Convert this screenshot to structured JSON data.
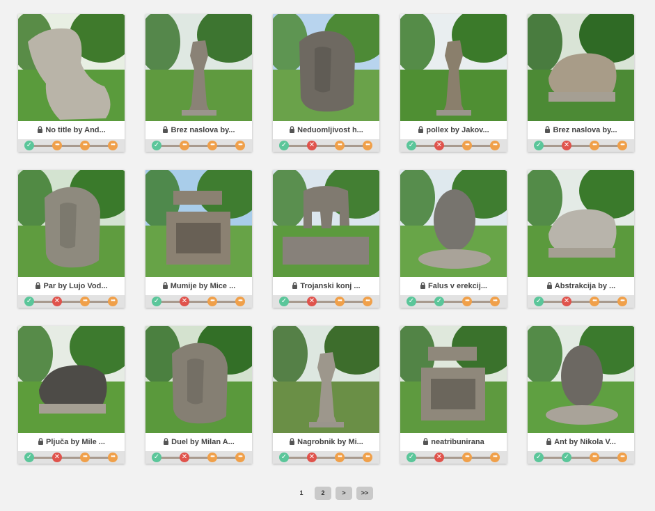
{
  "cards": [
    {
      "title": "No title by And...",
      "status": [
        "ok",
        "pend",
        "pend",
        "pend"
      ],
      "scene": {
        "sky": "#e8efe3",
        "grass": "#5a9b3c",
        "stone": "#b9b4a8",
        "shape": "tilt",
        "tree": "#3f7a2c"
      }
    },
    {
      "title": "Brez naslova by...",
      "status": [
        "ok",
        "pend",
        "pend",
        "pend"
      ],
      "scene": {
        "sky": "#dfe8e2",
        "grass": "#5f9a3f",
        "stone": "#8a8276",
        "shape": "pillar",
        "tree": "#3d7530"
      }
    },
    {
      "title": "Neduomljivost h...",
      "status": [
        "ok",
        "no",
        "pend",
        "pend"
      ],
      "scene": {
        "sky": "#b8d4ee",
        "grass": "#6aa24a",
        "stone": "#6e6961",
        "shape": "block",
        "tree": "#4d8a36"
      }
    },
    {
      "title": "pollex by Jakov...",
      "status": [
        "ok",
        "no",
        "pend",
        "pend"
      ],
      "scene": {
        "sky": "#e9eef0",
        "grass": "#4f8f33",
        "stone": "#8a7f6c",
        "shape": "pillar",
        "tree": "#3b7a2a"
      }
    },
    {
      "title": "Brez naslova by...",
      "status": [
        "ok",
        "no",
        "pend",
        "pend"
      ],
      "scene": {
        "sky": "#d9e4d6",
        "grass": "#4c8a35",
        "stone": "#a89c88",
        "shape": "low",
        "tree": "#2f6a25"
      }
    },
    {
      "title": "Par by Lujo Vod...",
      "status": [
        "ok",
        "no",
        "pend",
        "pend"
      ],
      "scene": {
        "sky": "#d3e3d0",
        "grass": "#5f9c3f",
        "stone": "#8e8a7e",
        "shape": "block",
        "tree": "#3a7a2b"
      }
    },
    {
      "title": "Mumije by Mice ...",
      "status": [
        "ok",
        "no",
        "pend",
        "pend"
      ],
      "scene": {
        "sky": "#a9cdea",
        "grass": "#67a347",
        "stone": "#8b8172",
        "shape": "table",
        "tree": "#3f7d30"
      }
    },
    {
      "title": "Trojanski konj ...",
      "status": [
        "ok",
        "no",
        "pend",
        "pend"
      ],
      "scene": {
        "sky": "#dbe6ee",
        "grass": "#5c9a3e",
        "stone": "#807a70",
        "shape": "horse",
        "tree": "#437f33"
      }
    },
    {
      "title": "Falus v erekcij...",
      "status": [
        "ok",
        "ok",
        "pend",
        "pend"
      ],
      "scene": {
        "sky": "#dfe9ee",
        "grass": "#68a548",
        "stone": "#77746e",
        "shape": "egg",
        "tree": "#3f7d30"
      }
    },
    {
      "title": "Abstrakcija by ...",
      "status": [
        "ok",
        "no",
        "pend",
        "pend"
      ],
      "scene": {
        "sky": "#e4ebe6",
        "grass": "#5b9a3d",
        "stone": "#b8b4ab",
        "shape": "low",
        "tree": "#3a7a2b"
      }
    },
    {
      "title": "Pljuča by Mile ...",
      "status": [
        "ok",
        "no",
        "pend",
        "pend"
      ],
      "scene": {
        "sky": "#e6ece4",
        "grass": "#5d9d3b",
        "stone": "#4d4b47",
        "shape": "low",
        "tree": "#3d7a2e"
      }
    },
    {
      "title": "Duel by Milan A...",
      "status": [
        "ok",
        "no",
        "pend",
        "pend"
      ],
      "scene": {
        "sky": "#d4e2cf",
        "grass": "#5a993c",
        "stone": "#857f73",
        "shape": "block",
        "tree": "#336f27"
      }
    },
    {
      "title": "Nagrobnik by Mi...",
      "status": [
        "ok",
        "no",
        "pend",
        "pend"
      ],
      "scene": {
        "sky": "#dde7e0",
        "grass": "#6a8f46",
        "stone": "#9d978c",
        "shape": "pillar",
        "tree": "#3d6d2c"
      }
    },
    {
      "title": "neatribunirana",
      "status": [
        "ok",
        "no",
        "pend",
        "pend"
      ],
      "scene": {
        "sky": "#dfe8dc",
        "grass": "#5e9a3f",
        "stone": "#8f887b",
        "shape": "table",
        "tree": "#3a722c"
      }
    },
    {
      "title": "Ant by Nikola V...",
      "status": [
        "ok",
        "ok",
        "pend",
        "pend"
      ],
      "scene": {
        "sky": "#e3ebe3",
        "grass": "#5fa041",
        "stone": "#6c6862",
        "shape": "egg",
        "tree": "#3b7a2d"
      }
    }
  ],
  "pagination": {
    "current": "1",
    "pages": [
      "2"
    ],
    "next": ">",
    "last": ">>"
  },
  "icons": {
    "ok": "check-icon",
    "no": "cross-icon",
    "pend": "more-icon",
    "lock": "lock-icon"
  }
}
